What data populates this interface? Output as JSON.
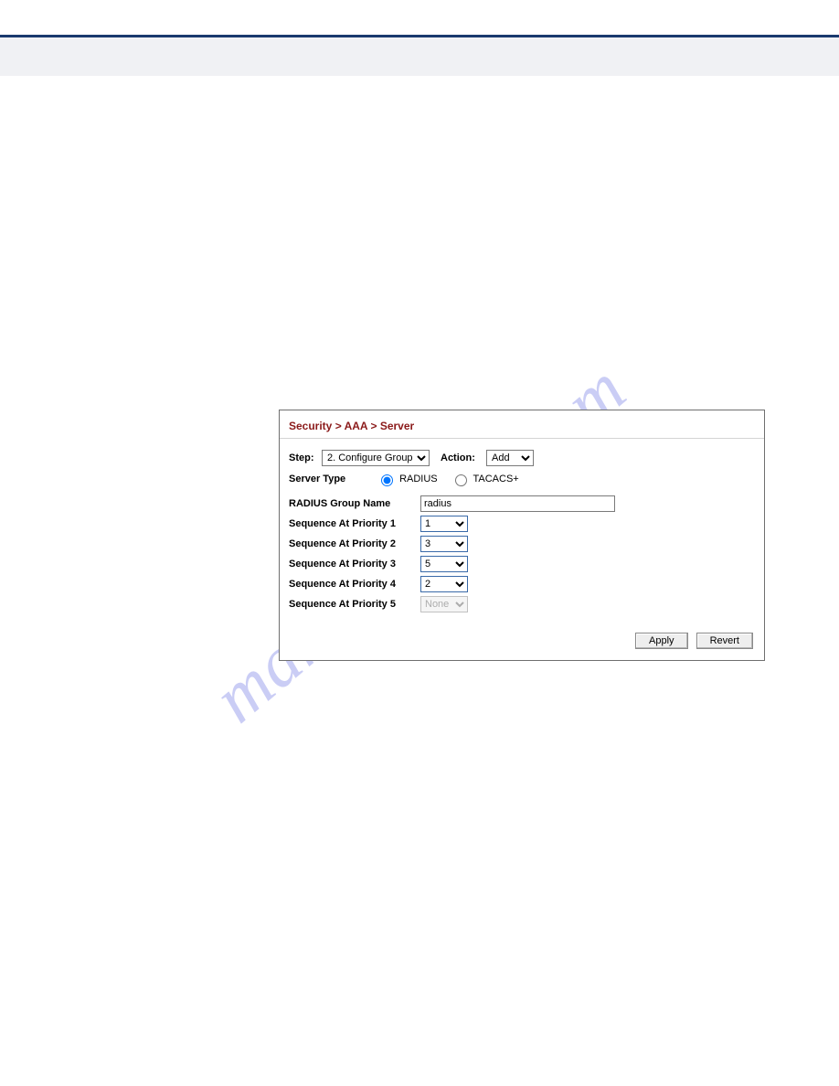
{
  "watermark": "manualshive.com",
  "breadcrumb": "Security > AAA > Server",
  "controls": {
    "step_label": "Step:",
    "step_value": "2. Configure Group",
    "action_label": "Action:",
    "action_value": "Add"
  },
  "server_type": {
    "label": "Server Type",
    "opt_radius": "RADIUS",
    "opt_tacacs": "TACACS+",
    "selected": "RADIUS"
  },
  "group_name": {
    "label": "RADIUS Group Name",
    "value": "radius"
  },
  "priorities": [
    {
      "label": "Sequence At Priority 1",
      "value": "1",
      "disabled": false
    },
    {
      "label": "Sequence At Priority 2",
      "value": "3",
      "disabled": false
    },
    {
      "label": "Sequence At Priority 3",
      "value": "5",
      "disabled": false
    },
    {
      "label": "Sequence At Priority 4",
      "value": "2",
      "disabled": false
    },
    {
      "label": "Sequence At Priority 5",
      "value": "None",
      "disabled": true
    }
  ],
  "buttons": {
    "apply": "Apply",
    "revert": "Revert"
  }
}
